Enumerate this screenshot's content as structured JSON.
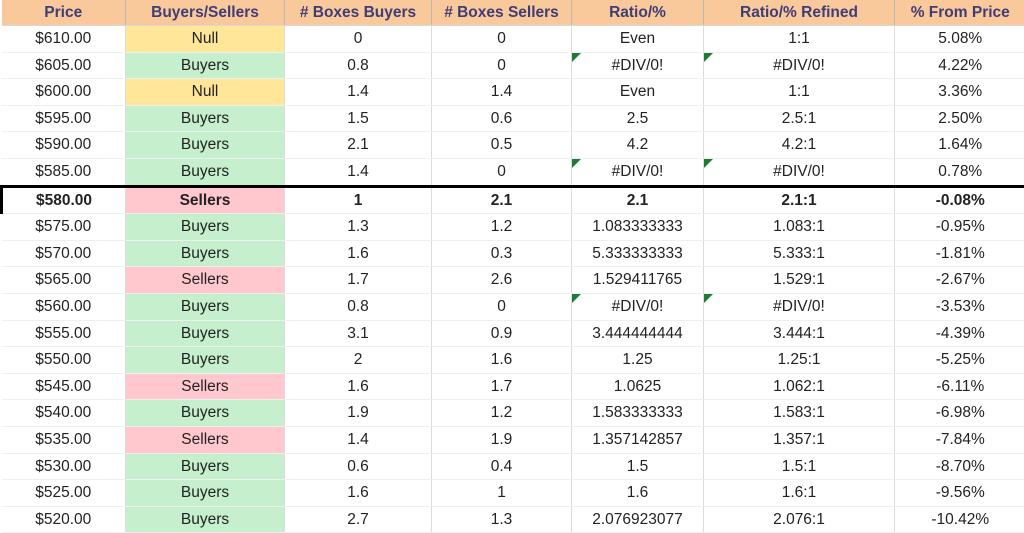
{
  "table": {
    "name": "price-ladder-buyers-sellers-table",
    "columns": [
      {
        "key": "price",
        "label": "Price"
      },
      {
        "key": "bs",
        "label": "Buyers/Sellers"
      },
      {
        "key": "boxes_b",
        "label": "# Boxes Buyers"
      },
      {
        "key": "boxes_s",
        "label": "# Boxes Sellers"
      },
      {
        "key": "ratio",
        "label": "Ratio/%"
      },
      {
        "key": "refined",
        "label": "Ratio/% Refined"
      },
      {
        "key": "pct",
        "label": "% From Price"
      }
    ],
    "header_bg": "#F9C99B",
    "header_fg": "#3F3D75",
    "buyers_bg": "#C6EFCE",
    "buyers_fg": "#216B29",
    "sellers_bg": "#FFC7CE",
    "sellers_fg": "#B3112E",
    "null_bg": "#FFE699",
    "null_fg": "#9C6500",
    "comment_marker_color": "#1E7B34",
    "highlight_border_color": "#000000",
    "rows": [
      {
        "price": "$610.00",
        "bs": "Null",
        "boxes_b": "0",
        "boxes_s": "0",
        "ratio": "Even",
        "refined": "1:1",
        "pct": "5.08%",
        "comment": false,
        "highlight": false
      },
      {
        "price": "$605.00",
        "bs": "Buyers",
        "boxes_b": "0.8",
        "boxes_s": "0",
        "ratio": "#DIV/0!",
        "refined": "#DIV/0!",
        "pct": "4.22%",
        "comment": true,
        "highlight": false
      },
      {
        "price": "$600.00",
        "bs": "Null",
        "boxes_b": "1.4",
        "boxes_s": "1.4",
        "ratio": "Even",
        "refined": "1:1",
        "pct": "3.36%",
        "comment": false,
        "highlight": false
      },
      {
        "price": "$595.00",
        "bs": "Buyers",
        "boxes_b": "1.5",
        "boxes_s": "0.6",
        "ratio": "2.5",
        "refined": "2.5:1",
        "pct": "2.50%",
        "comment": false,
        "highlight": false
      },
      {
        "price": "$590.00",
        "bs": "Buyers",
        "boxes_b": "2.1",
        "boxes_s": "0.5",
        "ratio": "4.2",
        "refined": "4.2:1",
        "pct": "1.64%",
        "comment": false,
        "highlight": false
      },
      {
        "price": "$585.00",
        "bs": "Buyers",
        "boxes_b": "1.4",
        "boxes_s": "0",
        "ratio": "#DIV/0!",
        "refined": "#DIV/0!",
        "pct": "0.78%",
        "comment": true,
        "highlight": false
      },
      {
        "price": "$580.00",
        "bs": "Sellers",
        "boxes_b": "1",
        "boxes_s": "2.1",
        "ratio": "2.1",
        "refined": "2.1:1",
        "pct": "-0.08%",
        "comment": false,
        "highlight": true
      },
      {
        "price": "$575.00",
        "bs": "Buyers",
        "boxes_b": "1.3",
        "boxes_s": "1.2",
        "ratio": "1.083333333",
        "refined": "1.083:1",
        "pct": "-0.95%",
        "comment": false,
        "highlight": false
      },
      {
        "price": "$570.00",
        "bs": "Buyers",
        "boxes_b": "1.6",
        "boxes_s": "0.3",
        "ratio": "5.333333333",
        "refined": "5.333:1",
        "pct": "-1.81%",
        "comment": false,
        "highlight": false
      },
      {
        "price": "$565.00",
        "bs": "Sellers",
        "boxes_b": "1.7",
        "boxes_s": "2.6",
        "ratio": "1.529411765",
        "refined": "1.529:1",
        "pct": "-2.67%",
        "comment": false,
        "highlight": false
      },
      {
        "price": "$560.00",
        "bs": "Buyers",
        "boxes_b": "0.8",
        "boxes_s": "0",
        "ratio": "#DIV/0!",
        "refined": "#DIV/0!",
        "pct": "-3.53%",
        "comment": true,
        "highlight": false
      },
      {
        "price": "$555.00",
        "bs": "Buyers",
        "boxes_b": "3.1",
        "boxes_s": "0.9",
        "ratio": "3.444444444",
        "refined": "3.444:1",
        "pct": "-4.39%",
        "comment": false,
        "highlight": false
      },
      {
        "price": "$550.00",
        "bs": "Buyers",
        "boxes_b": "2",
        "boxes_s": "1.6",
        "ratio": "1.25",
        "refined": "1.25:1",
        "pct": "-5.25%",
        "comment": false,
        "highlight": false
      },
      {
        "price": "$545.00",
        "bs": "Sellers",
        "boxes_b": "1.6",
        "boxes_s": "1.7",
        "ratio": "1.0625",
        "refined": "1.062:1",
        "pct": "-6.11%",
        "comment": false,
        "highlight": false
      },
      {
        "price": "$540.00",
        "bs": "Buyers",
        "boxes_b": "1.9",
        "boxes_s": "1.2",
        "ratio": "1.583333333",
        "refined": "1.583:1",
        "pct": "-6.98%",
        "comment": false,
        "highlight": false
      },
      {
        "price": "$535.00",
        "bs": "Sellers",
        "boxes_b": "1.4",
        "boxes_s": "1.9",
        "ratio": "1.357142857",
        "refined": "1.357:1",
        "pct": "-7.84%",
        "comment": false,
        "highlight": false
      },
      {
        "price": "$530.00",
        "bs": "Buyers",
        "boxes_b": "0.6",
        "boxes_s": "0.4",
        "ratio": "1.5",
        "refined": "1.5:1",
        "pct": "-8.70%",
        "comment": false,
        "highlight": false
      },
      {
        "price": "$525.00",
        "bs": "Buyers",
        "boxes_b": "1.6",
        "boxes_s": "1",
        "ratio": "1.6",
        "refined": "1.6:1",
        "pct": "-9.56%",
        "comment": false,
        "highlight": false
      },
      {
        "price": "$520.00",
        "bs": "Buyers",
        "boxes_b": "2.7",
        "boxes_s": "1.3",
        "ratio": "2.076923077",
        "refined": "2.076:1",
        "pct": "-10.42%",
        "comment": false,
        "highlight": false
      }
    ]
  }
}
